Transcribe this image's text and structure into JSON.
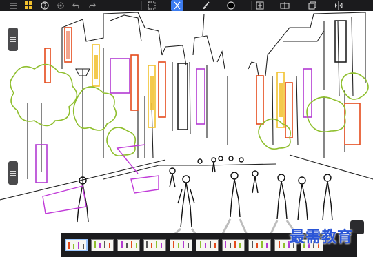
{
  "toolbar": {
    "left_tools": [
      {
        "name": "menu-icon"
      },
      {
        "name": "gallery-grid-icon"
      },
      {
        "name": "help-icon"
      },
      {
        "name": "gear-icon"
      },
      {
        "name": "undo-icon"
      },
      {
        "name": "redo-icon"
      }
    ],
    "center_tools": [
      {
        "name": "selection-icon"
      },
      {
        "name": "transform-icon",
        "active": true
      },
      {
        "name": "brush-icon"
      },
      {
        "name": "color-swatch-icon"
      }
    ],
    "right_tools": [
      {
        "name": "add-layer-icon"
      },
      {
        "name": "layer-options-icon"
      },
      {
        "name": "copy-layer-icon"
      },
      {
        "name": "symmetry-icon"
      }
    ],
    "active_color": "#3c7cf0",
    "bg_color": "#1b1b1d"
  },
  "canvas": {
    "artwork": "street-sketch-illustration"
  },
  "filmstrip": {
    "thumb_count": 10,
    "selected_index": 0
  },
  "watermark": {
    "text": "最需教育"
  }
}
